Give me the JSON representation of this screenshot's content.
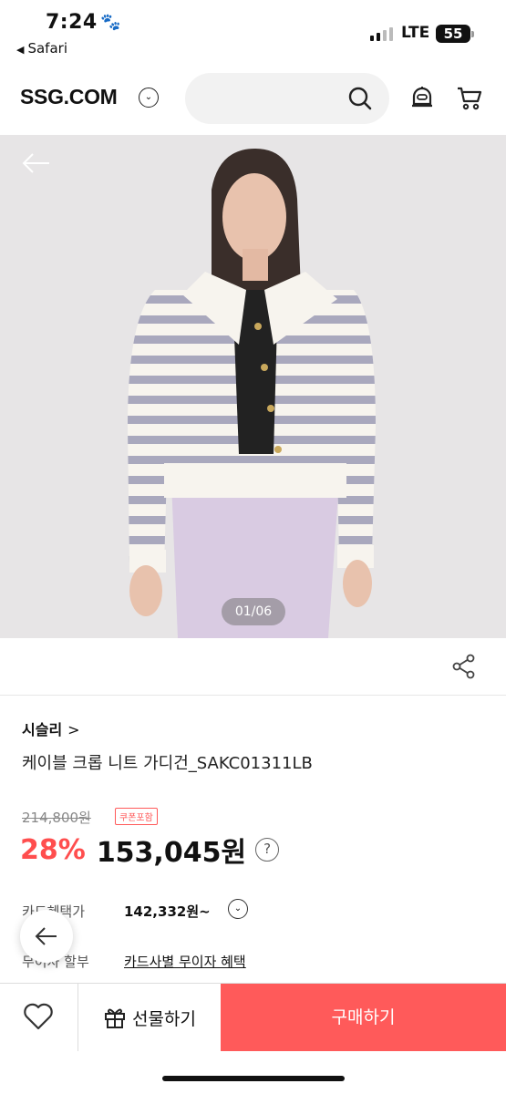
{
  "status_bar": {
    "time": "7:24",
    "back_app": "Safari",
    "network": "LTE",
    "battery": "55"
  },
  "header": {
    "logo": "SSG.COM",
    "search_placeholder": ""
  },
  "gallery": {
    "counter": "01/06"
  },
  "product": {
    "brand": "시슬리",
    "name": "케이블 크롭 니트 가디건_SAKC01311LB",
    "original_price": "214,800원",
    "coupon_badge": "쿠폰포함",
    "discount": "28%",
    "price": "153,045원",
    "card_benefit_label": "카드혜택가",
    "card_benefit_value": "142,332원~",
    "installment_label": "무이자 할부",
    "installment_link": "카드사별 무이자 혜택"
  },
  "bottom_bar": {
    "gift_label": "선물하기",
    "buy_label": "구매하기"
  },
  "colors": {
    "accent": "#ff5a5a",
    "discount": "#ff4e4e"
  }
}
